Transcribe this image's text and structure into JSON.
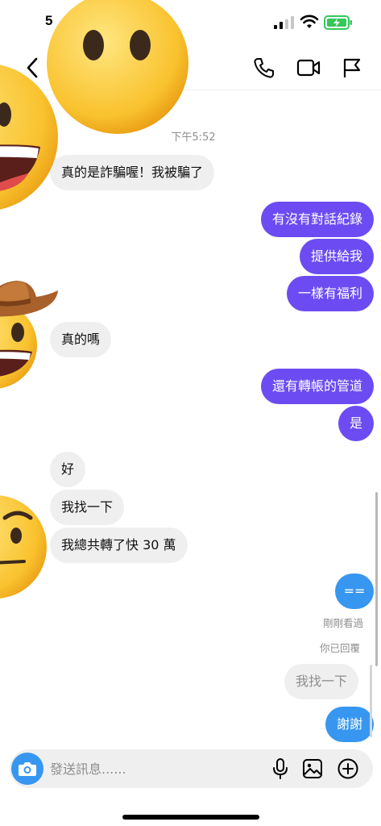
{
  "status_bar": {
    "time": "5"
  },
  "conversation": {
    "timestamp": "下午5:52",
    "messages": [
      {
        "from": "them",
        "text": "真的是詐騙喔！我被騙了"
      },
      {
        "from": "me",
        "text": "有沒有對話紀錄"
      },
      {
        "from": "me",
        "text": "提供給我"
      },
      {
        "from": "me",
        "text": "一樣有福利"
      },
      {
        "from": "them",
        "text": "真的嗎"
      },
      {
        "from": "me",
        "text": "還有轉帳的管道"
      },
      {
        "from": "me",
        "text": "是"
      },
      {
        "from": "them",
        "text": "好"
      },
      {
        "from": "them",
        "text": "我找一下"
      },
      {
        "from": "them",
        "text": "我總共轉了快 30 萬"
      },
      {
        "from": "me",
        "text": "=="
      },
      {
        "from": "me",
        "text": "謝謝"
      }
    ],
    "seen_label": "剛剛看過",
    "replied_label": "你已回覆",
    "reply_preview": "我找一下"
  },
  "composer": {
    "placeholder": "發送訊息......"
  },
  "icons": {
    "back": "chevron-left-icon",
    "call": "phone-icon",
    "video": "video-camera-icon",
    "report": "flag-icon",
    "camera": "camera-icon",
    "mic": "microphone-icon",
    "gallery": "image-icon",
    "add": "plus-circle-icon"
  },
  "colors": {
    "outgoing": "#6c4cf2",
    "incoming": "#efefef",
    "accent": "#3797f0",
    "battery": "#34c759"
  }
}
